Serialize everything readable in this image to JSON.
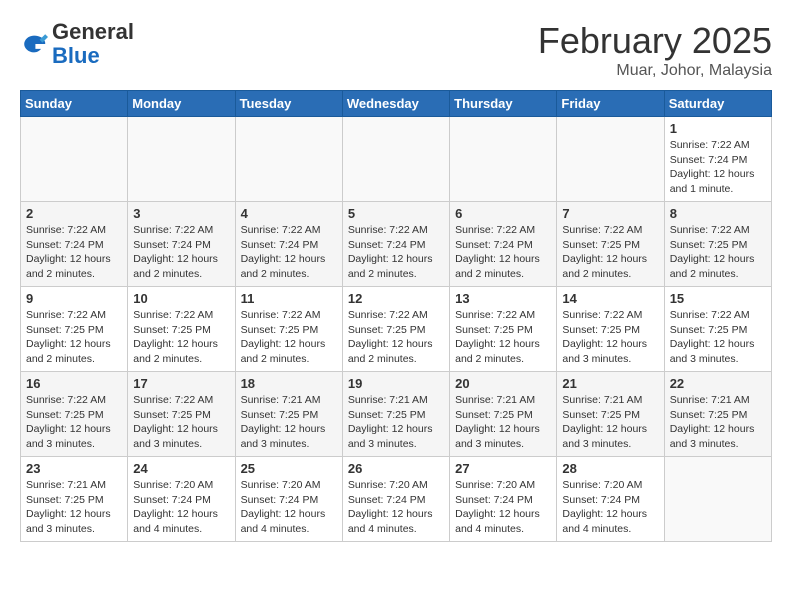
{
  "header": {
    "logo_general": "General",
    "logo_blue": "Blue",
    "month_title": "February 2025",
    "location": "Muar, Johor, Malaysia"
  },
  "days_of_week": [
    "Sunday",
    "Monday",
    "Tuesday",
    "Wednesday",
    "Thursday",
    "Friday",
    "Saturday"
  ],
  "weeks": [
    {
      "days": [
        {
          "date": "",
          "info": ""
        },
        {
          "date": "",
          "info": ""
        },
        {
          "date": "",
          "info": ""
        },
        {
          "date": "",
          "info": ""
        },
        {
          "date": "",
          "info": ""
        },
        {
          "date": "",
          "info": ""
        },
        {
          "date": "1",
          "info": "Sunrise: 7:22 AM\nSunset: 7:24 PM\nDaylight: 12 hours\nand 1 minute."
        }
      ]
    },
    {
      "days": [
        {
          "date": "2",
          "info": "Sunrise: 7:22 AM\nSunset: 7:24 PM\nDaylight: 12 hours\nand 2 minutes."
        },
        {
          "date": "3",
          "info": "Sunrise: 7:22 AM\nSunset: 7:24 PM\nDaylight: 12 hours\nand 2 minutes."
        },
        {
          "date": "4",
          "info": "Sunrise: 7:22 AM\nSunset: 7:24 PM\nDaylight: 12 hours\nand 2 minutes."
        },
        {
          "date": "5",
          "info": "Sunrise: 7:22 AM\nSunset: 7:24 PM\nDaylight: 12 hours\nand 2 minutes."
        },
        {
          "date": "6",
          "info": "Sunrise: 7:22 AM\nSunset: 7:24 PM\nDaylight: 12 hours\nand 2 minutes."
        },
        {
          "date": "7",
          "info": "Sunrise: 7:22 AM\nSunset: 7:25 PM\nDaylight: 12 hours\nand 2 minutes."
        },
        {
          "date": "8",
          "info": "Sunrise: 7:22 AM\nSunset: 7:25 PM\nDaylight: 12 hours\nand 2 minutes."
        }
      ]
    },
    {
      "days": [
        {
          "date": "9",
          "info": "Sunrise: 7:22 AM\nSunset: 7:25 PM\nDaylight: 12 hours\nand 2 minutes."
        },
        {
          "date": "10",
          "info": "Sunrise: 7:22 AM\nSunset: 7:25 PM\nDaylight: 12 hours\nand 2 minutes."
        },
        {
          "date": "11",
          "info": "Sunrise: 7:22 AM\nSunset: 7:25 PM\nDaylight: 12 hours\nand 2 minutes."
        },
        {
          "date": "12",
          "info": "Sunrise: 7:22 AM\nSunset: 7:25 PM\nDaylight: 12 hours\nand 2 minutes."
        },
        {
          "date": "13",
          "info": "Sunrise: 7:22 AM\nSunset: 7:25 PM\nDaylight: 12 hours\nand 2 minutes."
        },
        {
          "date": "14",
          "info": "Sunrise: 7:22 AM\nSunset: 7:25 PM\nDaylight: 12 hours\nand 3 minutes."
        },
        {
          "date": "15",
          "info": "Sunrise: 7:22 AM\nSunset: 7:25 PM\nDaylight: 12 hours\nand 3 minutes."
        }
      ]
    },
    {
      "days": [
        {
          "date": "16",
          "info": "Sunrise: 7:22 AM\nSunset: 7:25 PM\nDaylight: 12 hours\nand 3 minutes."
        },
        {
          "date": "17",
          "info": "Sunrise: 7:22 AM\nSunset: 7:25 PM\nDaylight: 12 hours\nand 3 minutes."
        },
        {
          "date": "18",
          "info": "Sunrise: 7:21 AM\nSunset: 7:25 PM\nDaylight: 12 hours\nand 3 minutes."
        },
        {
          "date": "19",
          "info": "Sunrise: 7:21 AM\nSunset: 7:25 PM\nDaylight: 12 hours\nand 3 minutes."
        },
        {
          "date": "20",
          "info": "Sunrise: 7:21 AM\nSunset: 7:25 PM\nDaylight: 12 hours\nand 3 minutes."
        },
        {
          "date": "21",
          "info": "Sunrise: 7:21 AM\nSunset: 7:25 PM\nDaylight: 12 hours\nand 3 minutes."
        },
        {
          "date": "22",
          "info": "Sunrise: 7:21 AM\nSunset: 7:25 PM\nDaylight: 12 hours\nand 3 minutes."
        }
      ]
    },
    {
      "days": [
        {
          "date": "23",
          "info": "Sunrise: 7:21 AM\nSunset: 7:25 PM\nDaylight: 12 hours\nand 3 minutes."
        },
        {
          "date": "24",
          "info": "Sunrise: 7:20 AM\nSunset: 7:24 PM\nDaylight: 12 hours\nand 4 minutes."
        },
        {
          "date": "25",
          "info": "Sunrise: 7:20 AM\nSunset: 7:24 PM\nDaylight: 12 hours\nand 4 minutes."
        },
        {
          "date": "26",
          "info": "Sunrise: 7:20 AM\nSunset: 7:24 PM\nDaylight: 12 hours\nand 4 minutes."
        },
        {
          "date": "27",
          "info": "Sunrise: 7:20 AM\nSunset: 7:24 PM\nDaylight: 12 hours\nand 4 minutes."
        },
        {
          "date": "28",
          "info": "Sunrise: 7:20 AM\nSunset: 7:24 PM\nDaylight: 12 hours\nand 4 minutes."
        },
        {
          "date": "",
          "info": ""
        }
      ]
    }
  ]
}
